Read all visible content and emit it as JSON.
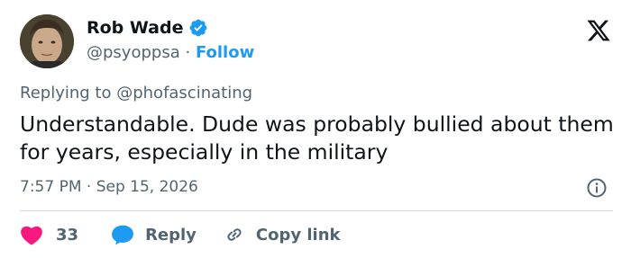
{
  "author": {
    "name": "Rob Wade",
    "handle": "@psyoppsa",
    "separator": "·",
    "follow_label": "Follow",
    "verified": true
  },
  "platform_icon": "x-logo-icon",
  "replying": {
    "prefix": "Replying to",
    "mention": "@phofascinating"
  },
  "tweet": {
    "text": "Understandable. Dude was probably bullied about them for years, especially in the military",
    "timestamp": "7:57 PM · Sep 15, 2026"
  },
  "actions": {
    "like_count": "33",
    "reply_label": "Reply",
    "copy_label": "Copy link"
  },
  "colors": {
    "accent": "#1d9bf0",
    "like": "#f91880",
    "muted": "#536471",
    "text": "#0f1419"
  }
}
